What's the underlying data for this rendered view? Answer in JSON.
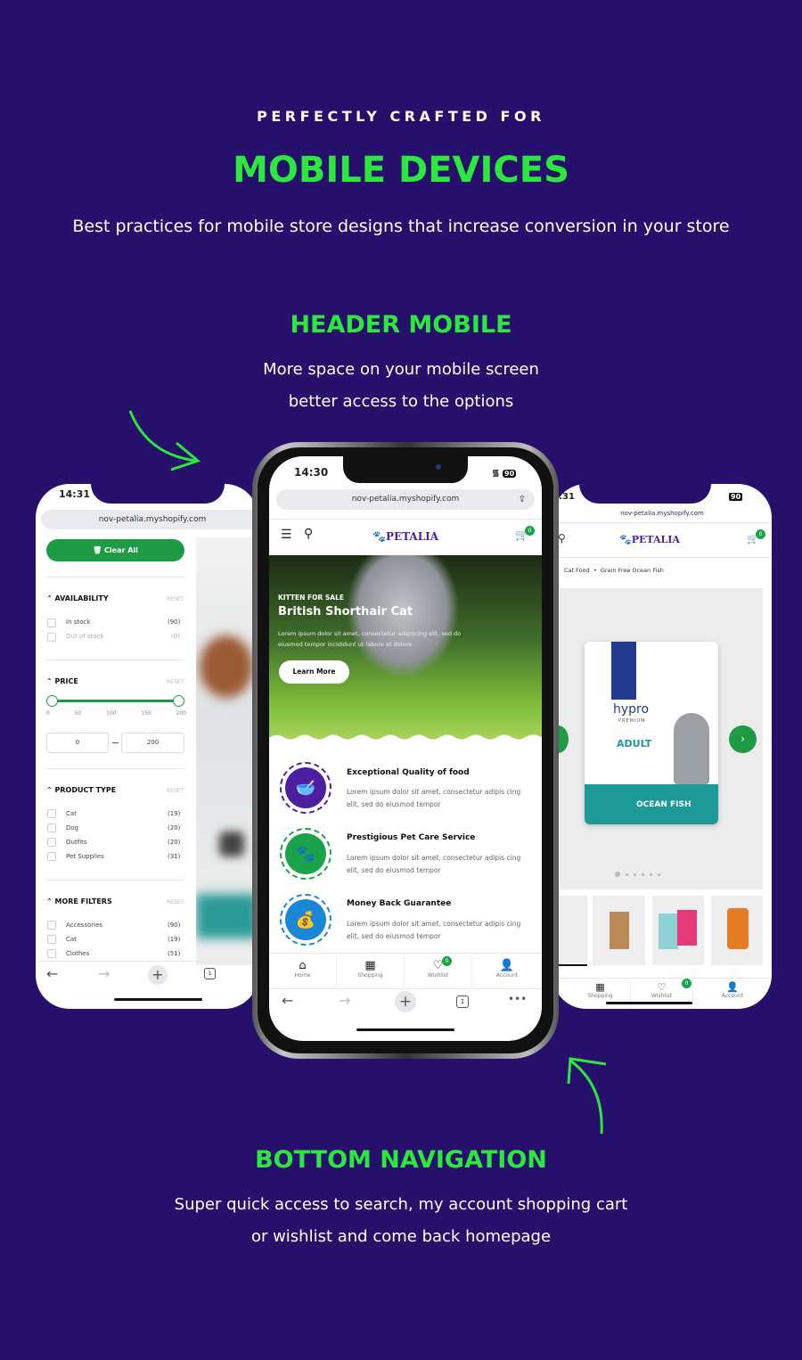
{
  "intro": {
    "kicker": "PERFECTLY CRAFTED FOR",
    "title": "MOBILE DEVICES",
    "subtitle": "Best practices for mobile store designs that increase conversion in your store"
  },
  "header_section": {
    "title": "HEADER MOBILE",
    "line1": "More space on your mobile screen",
    "line2": "better access to the options"
  },
  "bottom_section": {
    "title": "BOTTOM NAVIGATION",
    "line1": "Super quick access to search, my account shopping cart",
    "line2": "or wishlist and come back homepage"
  },
  "colors": {
    "background": "#27106b",
    "accent": "#2ce83e",
    "brand_green": "#1aa34a",
    "brand_purple": "#4b1fa0"
  },
  "url": "nov-petalia.myshopify.com",
  "brand": "PETALIA",
  "cart_count": "0",
  "wishlist_count": "0",
  "battery": "90",
  "left_phone": {
    "time": "14:31",
    "clear_all": "Clear All",
    "reset": "RESET",
    "availability": {
      "title": "AVAILABILITY",
      "items": [
        {
          "label": "In stock",
          "count": "(90)"
        },
        {
          "label": "Out of stock",
          "count": "(0)"
        }
      ]
    },
    "price": {
      "title": "PRICE",
      "ticks": [
        "0",
        "50",
        "100",
        "150",
        "200"
      ],
      "min": "0",
      "max": "200",
      "range": [
        0,
        200
      ]
    },
    "product_type": {
      "title": "PRODUCT TYPE",
      "items": [
        {
          "label": "Cat",
          "count": "(19)"
        },
        {
          "label": "Dog",
          "count": "(20)"
        },
        {
          "label": "Outfits",
          "count": "(20)"
        },
        {
          "label": "Pet Supplies",
          "count": "(31)"
        }
      ]
    },
    "more_filters": {
      "title": "MORE FILTERS",
      "items": [
        {
          "label": "Accessories",
          "count": "(90)"
        },
        {
          "label": "Cat",
          "count": "(19)"
        },
        {
          "label": "Clothes",
          "count": "(51)"
        }
      ]
    },
    "tab_count": "1"
  },
  "center_phone": {
    "time": "14:30",
    "hero": {
      "kicker": "KITTEN FOR SALE",
      "title": "British Shorthair Cat",
      "desc": "Lorem ipsum dolor sit amet, consectetur adipiscing elit, sed do eiusmod tempor incididunt ut labore et dolore",
      "button": "Learn More"
    },
    "features": [
      {
        "title": "Exceptional Quality of food",
        "desc": "Lorem ipsum dolor sit amet, consectetur adipis cing elit, sed do eiusmod tempor",
        "icon": "bowl-icon",
        "color": "#4b1fa0"
      },
      {
        "title": "Prestigious Pet Care Service",
        "desc": "Lorem ipsum dolor sit amet, consectetur adipis cing elit, sed do eiusmod tempor",
        "icon": "paw-icon",
        "color": "#1aa34a"
      },
      {
        "title": "Money Back Guarantee",
        "desc": "Lorem ipsum dolor sit amet, consectetur adipis cing elit, sed do eiusmod tempor",
        "icon": "money-bag-icon",
        "color": "#1a86d6"
      }
    ],
    "nav": [
      "Home",
      "Shopping",
      "Wishlist",
      "Account"
    ],
    "tab_count": "1"
  },
  "right_phone": {
    "time": ":31",
    "breadcrumb": [
      "Cat Food",
      "Grain Free Ocean Fish"
    ],
    "product_text": [
      "hypro",
      "PREMIUM",
      "ADULT",
      "OCEAN FISH"
    ],
    "gallery_dots": 6,
    "nav": [
      "Shopping",
      "Wishlist",
      "Account"
    ]
  }
}
